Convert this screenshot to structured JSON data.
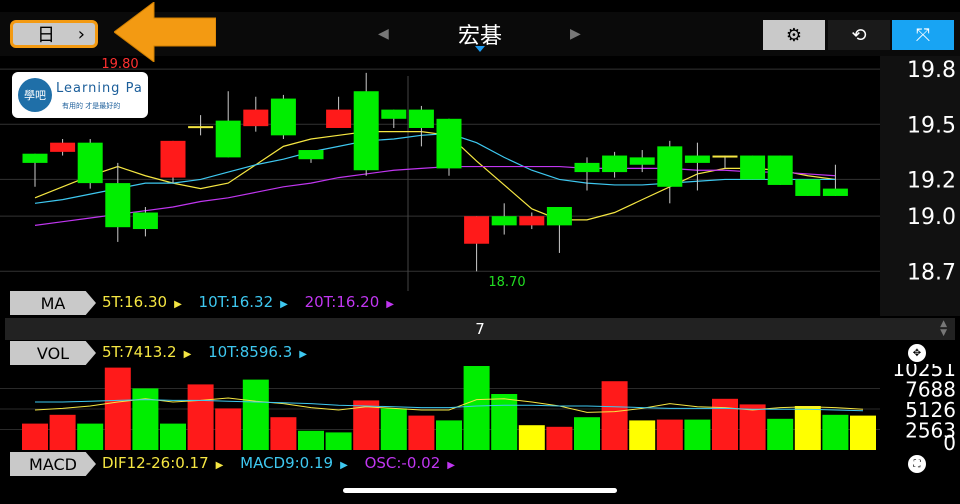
{
  "toolbar": {
    "period_label": "日",
    "period_chevron": "›",
    "stock_name": "宏碁",
    "prev_arrow": "◀",
    "next_arrow": "▶",
    "settings_icon": "gear-icon",
    "rotate_icon": "rotate-icon",
    "fullscreen_icon": "fullscreen-toggle-icon",
    "accent_color": "#18a4f3",
    "highlight_color": "#f39a12"
  },
  "logo": {
    "text": "Learning Pa",
    "subtitle": "有用的 才是最好的",
    "mark": "學吧"
  },
  "price_chart": {
    "y_ticks": [
      "19.8",
      "19.5",
      "19.2",
      "19.0",
      "18.7"
    ],
    "high_label": "19.80",
    "low_label": "18.70",
    "up_color": "#ff1a1a",
    "down_color": "#00ee00"
  },
  "ma_bar": {
    "label": "MA",
    "ma5": "5T:16.30",
    "ma10": "10T:16.32",
    "ma20": "20T:16.20",
    "ma5_color": "#f5e642",
    "ma10_color": "#3ec8f0",
    "ma20_color": "#c036f0"
  },
  "separator": {
    "value": "7"
  },
  "vol_bar": {
    "label": "VOL",
    "ma5": "5T:7413.2",
    "ma10": "10T:8596.3",
    "y_ticks": [
      "10251",
      "7688",
      "5126",
      "2563",
      "0"
    ]
  },
  "macd_bar": {
    "label": "MACD",
    "dif": "DIF12-26:0.17",
    "macd": "MACD9:0.19",
    "osc": "OSC:-0.02"
  },
  "chart_data": [
    {
      "type": "candlestick",
      "title": "",
      "ylim": [
        18.62,
        19.85
      ],
      "y_ticks": [
        18.7,
        19.0,
        19.2,
        19.5,
        19.8
      ],
      "grid": true,
      "candles": [
        {
          "open": 19.34,
          "close": 19.29,
          "high": 19.34,
          "low": 19.16,
          "dir": "down"
        },
        {
          "open": 19.35,
          "close": 19.4,
          "high": 19.42,
          "low": 19.33,
          "dir": "up"
        },
        {
          "open": 19.4,
          "close": 19.18,
          "high": 19.42,
          "low": 19.15,
          "dir": "down"
        },
        {
          "open": 19.18,
          "close": 18.94,
          "high": 19.29,
          "low": 18.86,
          "dir": "down"
        },
        {
          "open": 19.02,
          "close": 18.93,
          "high": 19.05,
          "low": 18.89,
          "dir": "down"
        },
        {
          "open": 19.21,
          "close": 19.41,
          "high": 19.41,
          "low": 19.18,
          "dir": "up"
        },
        {
          "open": 19.49,
          "close": 19.48,
          "high": 19.55,
          "low": 19.44,
          "dir": "flat"
        },
        {
          "open": 19.52,
          "close": 19.32,
          "high": 19.68,
          "low": 19.32,
          "dir": "down"
        },
        {
          "open": 19.49,
          "close": 19.58,
          "high": 19.65,
          "low": 19.46,
          "dir": "up"
        },
        {
          "open": 19.64,
          "close": 19.44,
          "high": 19.66,
          "low": 19.42,
          "dir": "down"
        },
        {
          "open": 19.36,
          "close": 19.31,
          "high": 19.36,
          "low": 19.29,
          "dir": "down"
        },
        {
          "open": 19.48,
          "close": 19.58,
          "high": 19.65,
          "low": 19.48,
          "dir": "up"
        },
        {
          "open": 19.68,
          "close": 19.25,
          "high": 19.78,
          "low": 19.22,
          "dir": "down"
        },
        {
          "open": 19.58,
          "close": 19.53,
          "high": 19.58,
          "low": 19.48,
          "dir": "down"
        },
        {
          "open": 19.58,
          "close": 19.48,
          "high": 19.6,
          "low": 19.38,
          "dir": "down"
        },
        {
          "open": 19.53,
          "close": 19.26,
          "high": 19.53,
          "low": 19.22,
          "dir": "down"
        },
        {
          "open": 18.85,
          "close": 19.0,
          "high": 19.0,
          "low": 18.7,
          "dir": "up"
        },
        {
          "open": 19.0,
          "close": 18.95,
          "high": 19.07,
          "low": 18.9,
          "dir": "down"
        },
        {
          "open": 18.95,
          "close": 19.0,
          "high": 19.02,
          "low": 18.93,
          "dir": "up"
        },
        {
          "open": 19.05,
          "close": 18.95,
          "high": 19.05,
          "low": 18.8,
          "dir": "down"
        },
        {
          "open": 19.29,
          "close": 19.24,
          "high": 19.32,
          "low": 19.14,
          "dir": "down"
        },
        {
          "open": 19.33,
          "close": 19.24,
          "high": 19.35,
          "low": 19.21,
          "dir": "down"
        },
        {
          "open": 19.32,
          "close": 19.28,
          "high": 19.36,
          "low": 19.24,
          "dir": "down"
        },
        {
          "open": 19.38,
          "close": 19.16,
          "high": 19.41,
          "low": 19.07,
          "dir": "down"
        },
        {
          "open": 19.33,
          "close": 19.29,
          "high": 19.4,
          "low": 19.14,
          "dir": "down"
        },
        {
          "open": 19.33,
          "close": 19.32,
          "high": 19.33,
          "low": 19.26,
          "dir": "flat"
        },
        {
          "open": 19.33,
          "close": 19.2,
          "high": 19.33,
          "low": 19.2,
          "dir": "down"
        },
        {
          "open": 19.33,
          "close": 19.17,
          "high": 19.33,
          "low": 19.17,
          "dir": "down"
        },
        {
          "open": 19.2,
          "close": 19.11,
          "high": 19.2,
          "low": 19.11,
          "dir": "down"
        },
        {
          "open": 19.15,
          "close": 19.11,
          "high": 19.28,
          "low": 19.11,
          "dir": "down"
        }
      ],
      "series": [
        {
          "name": "5T",
          "color": "#f5e642",
          "values": [
            19.1,
            19.16,
            19.22,
            19.27,
            19.22,
            19.18,
            19.15,
            19.18,
            19.28,
            19.38,
            19.42,
            19.44,
            19.46,
            19.46,
            19.46,
            19.44,
            19.3,
            19.17,
            19.04,
            18.98,
            18.98,
            19.02,
            19.09,
            19.16,
            19.23,
            19.26,
            19.26,
            19.25,
            19.22,
            19.2
          ]
        },
        {
          "name": "10T",
          "color": "#3ec8f0",
          "values": [
            19.07,
            19.09,
            19.12,
            19.15,
            19.18,
            19.18,
            19.2,
            19.24,
            19.28,
            19.31,
            19.35,
            19.38,
            19.41,
            19.42,
            19.44,
            19.45,
            19.4,
            19.32,
            19.25,
            19.2,
            19.18,
            19.17,
            19.17,
            19.18,
            19.19,
            19.2,
            19.2,
            19.2,
            19.2,
            19.2
          ]
        },
        {
          "name": "20T",
          "color": "#c036f0",
          "values": [
            18.95,
            18.97,
            18.99,
            19.01,
            19.03,
            19.05,
            19.08,
            19.1,
            19.13,
            19.16,
            19.18,
            19.21,
            19.23,
            19.25,
            19.26,
            19.27,
            19.27,
            19.27,
            19.27,
            19.27,
            19.26,
            19.26,
            19.26,
            19.26,
            19.25,
            19.25,
            19.24,
            19.24,
            19.23,
            19.22
          ]
        }
      ]
    },
    {
      "type": "bar",
      "title": "",
      "ylim": [
        0,
        10251
      ],
      "y_ticks": [
        0,
        2563,
        5126,
        7688,
        10251
      ],
      "values": [
        3300,
        4400,
        3300,
        10300,
        7700,
        3300,
        8200,
        5200,
        8800,
        4100,
        2400,
        2200,
        6200,
        5200,
        4300,
        3700,
        10500,
        7000,
        3100,
        2900,
        4100,
        8600,
        3700,
        3800,
        3800,
        6400,
        5700,
        3900,
        5500,
        4400,
        4300
      ],
      "colors": [
        "red",
        "red",
        "green",
        "red",
        "green",
        "green",
        "red",
        "red",
        "green",
        "red",
        "green",
        "green",
        "red",
        "green",
        "red",
        "green",
        "green",
        "green",
        "yellow",
        "red",
        "green",
        "red",
        "yellow",
        "red",
        "green",
        "red",
        "red",
        "green",
        "yellow",
        "green",
        "yellow"
      ],
      "series": [
        {
          "name": "5T",
          "color": "#f5e642",
          "values": [
            5000,
            5200,
            5500,
            6000,
            6400,
            6000,
            6200,
            6500,
            6100,
            5800,
            5300,
            5000,
            5400,
            5200,
            5000,
            5000,
            6300,
            6400,
            6000,
            5500,
            4700,
            4800,
            5200,
            5800,
            5400,
            5300,
            5000,
            5300,
            5400,
            5300,
            5100
          ]
        },
        {
          "name": "10T",
          "color": "#3ec8f0",
          "values": [
            6000,
            6000,
            6100,
            6200,
            6300,
            6200,
            6200,
            6100,
            6000,
            5900,
            5800,
            5600,
            5500,
            5400,
            5300,
            5300,
            5500,
            5600,
            5600,
            5500,
            5500,
            5400,
            5300,
            5200,
            5200,
            5200,
            5100,
            5100,
            5100,
            5000,
            4900
          ]
        }
      ]
    }
  ]
}
